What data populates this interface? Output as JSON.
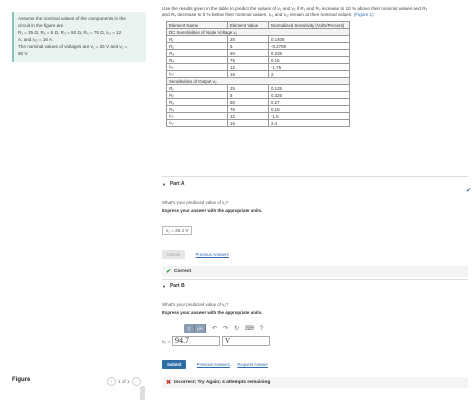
{
  "problem": {
    "line1": "Assume the nominal values of the components in the",
    "line2": "circuit in the figure are",
    "line3": "R₁ = 25 Ω, R₂ = 5 Ω, R₃ = 50 Ω, R₄ = 75 Ω, Iₚ₁ = 12",
    "line4": "A, and Iₚ₂ = 16 A.",
    "line5": "The nominal values of voltages are v₁ = 25 V and v₂ =",
    "line6": "90 V."
  },
  "figure": {
    "title": "Figure",
    "pager": "1 of 1",
    "prev": "‹",
    "next": "›"
  },
  "intro": {
    "text1": "Use the results given in the table to predict the values of v₁ and v₂ if R₁ and R₂ increase to 10 % above their nominal values and R₃",
    "text2": "and R₄ decrease to 5 % below their nominal values. Iₚ₁ and Iₚ₂ remain at their nominal values.",
    "figure_link": "(Figure 1)"
  },
  "table": {
    "headers": [
      "Element Name",
      "Element Value",
      "Normalized Sensitivity (Volts/Percent)"
    ],
    "section1": "DC Sensitivities of Node Voltage v₁",
    "rows1": [
      [
        "R₁",
        "25",
        "0.1408"
      ],
      [
        "R₂",
        "5",
        "-0.2708"
      ],
      [
        "R₃",
        "50",
        "0.225"
      ],
      [
        "R₄",
        "75",
        "0.15"
      ],
      [
        "Iₚ₁",
        "12",
        "-1.75"
      ],
      [
        "Iₚ₂",
        "16",
        "2"
      ]
    ],
    "section2": "Sensitivities of Output v₂",
    "rows2": [
      [
        "R₁",
        "25",
        "0.125"
      ],
      [
        "R₂",
        "5",
        "0.325"
      ],
      [
        "R₃",
        "50",
        "0.27"
      ],
      [
        "R₄",
        "75",
        "0.18"
      ],
      [
        "Iₚ₁",
        "12",
        "-1.5"
      ],
      [
        "Iₚ₂",
        "16",
        "2.4"
      ]
    ]
  },
  "partA": {
    "title": "Part A",
    "question": "What's your predicted value of v₁?",
    "instruction": "Express your answer with the appropriate units.",
    "answer": "v₁ = 25.4 V",
    "submit": "Submit",
    "prev_answers": "Previous Answers",
    "feedback": "Correct"
  },
  "partB": {
    "title": "Part B",
    "question": "What's your predicted value of v₂?",
    "instruction": "Express your answer with the appropriate units.",
    "label": "v₂ =",
    "value": "94.7",
    "unit": "V",
    "submit": "Submit",
    "prev_answers": "Previous Answers",
    "request_answer": "Request Answer",
    "feedback": "Incorrect; Try Again; 4 attempts remaining",
    "toolbar": {
      "templates": "▯",
      "mu": "μA",
      "undo": "↶",
      "redo": "↷",
      "reset": "↻",
      "keyboard": "⌨",
      "help": "?"
    }
  }
}
